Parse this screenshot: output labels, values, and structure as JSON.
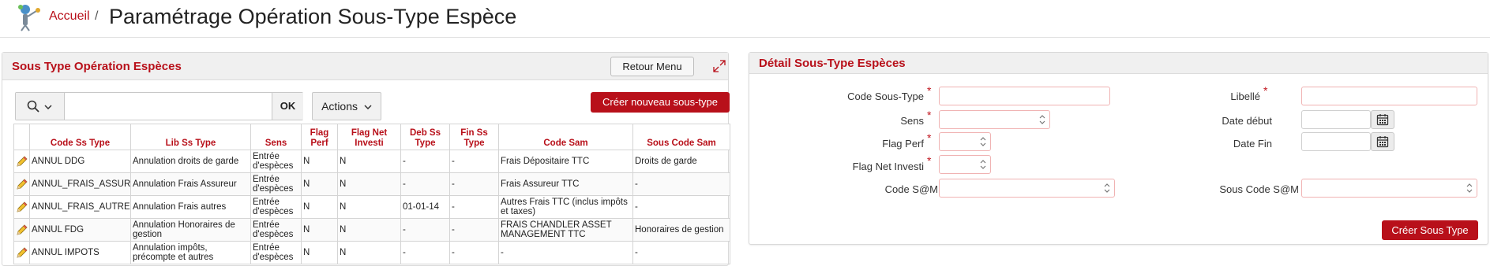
{
  "breadcrumb": {
    "home": "Accueil",
    "separator": "/"
  },
  "page_title": "Paramétrage Opération Sous-Type Espèce",
  "left_region": {
    "title": "Sous Type Opération Espèces",
    "retour_label": "Retour Menu",
    "search": {
      "value": "",
      "placeholder": ""
    },
    "ok_label": "OK",
    "actions_label": "Actions",
    "create_label": "Créer nouveau sous-type",
    "columns": [
      "Code Ss Type",
      "Lib Ss Type",
      "Sens",
      "Flag Perf",
      "Flag Net Investi",
      "Deb Ss Type",
      "Fin Ss Type",
      "Code Sam",
      "Sous Code Sam"
    ],
    "rows": [
      [
        "ANNUL DDG",
        "Annulation droits de garde",
        "Entrée d'espèces",
        "N",
        "N",
        "-",
        "-",
        "Frais Dépositaire TTC",
        "Droits de garde"
      ],
      [
        "ANNUL_FRAIS_ASSUR",
        "Annulation Frais Assureur",
        "Entrée d'espèces",
        "N",
        "N",
        "-",
        "-",
        "Frais Assureur TTC",
        "-"
      ],
      [
        "ANNUL_FRAIS_AUTRES",
        "Annulation Frais autres",
        "Entrée d'espèces",
        "N",
        "N",
        "01-01-14",
        "-",
        "Autres Frais TTC (inclus impôts et taxes)",
        "-"
      ],
      [
        "ANNUL FDG",
        "Annulation Honoraires de gestion",
        "Entrée d'espèces",
        "N",
        "N",
        "-",
        "-",
        "FRAIS CHANDLER ASSET MANAGEMENT TTC",
        "Honoraires de gestion"
      ],
      [
        "ANNUL IMPOTS",
        "Annulation impôts, précompte et autres",
        "Entrée d'espèces",
        "N",
        "N",
        "-",
        "-",
        "-",
        "-"
      ]
    ]
  },
  "right_region": {
    "title": "Détail Sous-Type Espèces",
    "code_sous_type": {
      "label": "Code Sous-Type",
      "value": ""
    },
    "libelle": {
      "label": "Libellé",
      "value": ""
    },
    "sens": {
      "label": "Sens",
      "value": ""
    },
    "date_debut": {
      "label": "Date début",
      "value": ""
    },
    "flag_perf": {
      "label": "Flag Perf",
      "value": ""
    },
    "date_fin": {
      "label": "Date Fin",
      "value": ""
    },
    "flag_net_investi": {
      "label": "Flag Net Investi",
      "value": ""
    },
    "code_sam": {
      "label": "Code S@M",
      "value": ""
    },
    "sous_code_sam": {
      "label": "Sous Code S@M",
      "value": ""
    },
    "required_mark": "*",
    "create_label": "Créer Sous Type"
  },
  "colors": {
    "accent": "#b8101a",
    "required_border": "#f0b3b3"
  },
  "icons": [
    "logo-icon",
    "expand-icon",
    "search-icon",
    "chevron-down-icon",
    "pencil-icon",
    "calendar-icon",
    "select-arrows-icon"
  ]
}
